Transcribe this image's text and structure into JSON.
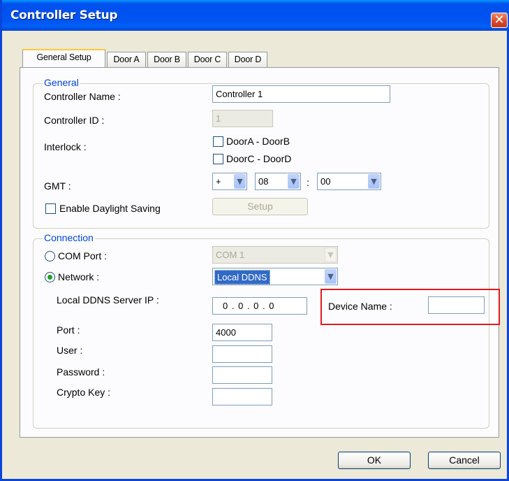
{
  "window": {
    "title": "Controller Setup",
    "close_glyph": "✕"
  },
  "tabs": [
    {
      "label": "General Setup",
      "active": true
    },
    {
      "label": "Door A",
      "active": false
    },
    {
      "label": "Door B",
      "active": false
    },
    {
      "label": "Door C",
      "active": false
    },
    {
      "label": "Door D",
      "active": false
    }
  ],
  "general": {
    "group_label": "General",
    "controller_name_label": "Controller Name :",
    "controller_name_value": "Controller 1",
    "controller_id_label": "Controller ID :",
    "controller_id_value": "1",
    "interlock_label": "Interlock :",
    "interlock_ab_label": "DoorA - DoorB",
    "interlock_cd_label": "DoorC - DoorD",
    "gmt_label": "GMT :",
    "gmt_sign": "+",
    "gmt_hour": "08",
    "gmt_separator": ":",
    "gmt_minute": "00",
    "daylight_label": "Enable Daylight Saving",
    "setup_button": "Setup"
  },
  "connection": {
    "group_label": "Connection",
    "com_port_label": "COM Port :",
    "com_port_value": "COM 1",
    "network_label": "Network :",
    "network_value": "Local DDNS",
    "ddns_ip_label": "Local DDNS Server IP :",
    "ddns_ip_value": "0 . 0 . 0 . 0",
    "device_name_label": "Device Name :",
    "device_name_value": "",
    "port_label": "Port :",
    "port_value": "4000",
    "user_label": "User :",
    "user_value": "",
    "password_label": "Password :",
    "password_value": "",
    "crypto_key_label": "Crypto Key :",
    "crypto_key_value": ""
  },
  "footer": {
    "ok_label": "OK",
    "cancel_label": "Cancel"
  },
  "colors": {
    "title_bar": "#0054E3",
    "group_label": "#0046D5",
    "highlight": "#E0191E",
    "window_bg": "#ECE9D8"
  },
  "icons": {
    "close": "close-icon",
    "dropdown": "chevron-down-icon",
    "radio_selected": "radio-selected-icon"
  }
}
